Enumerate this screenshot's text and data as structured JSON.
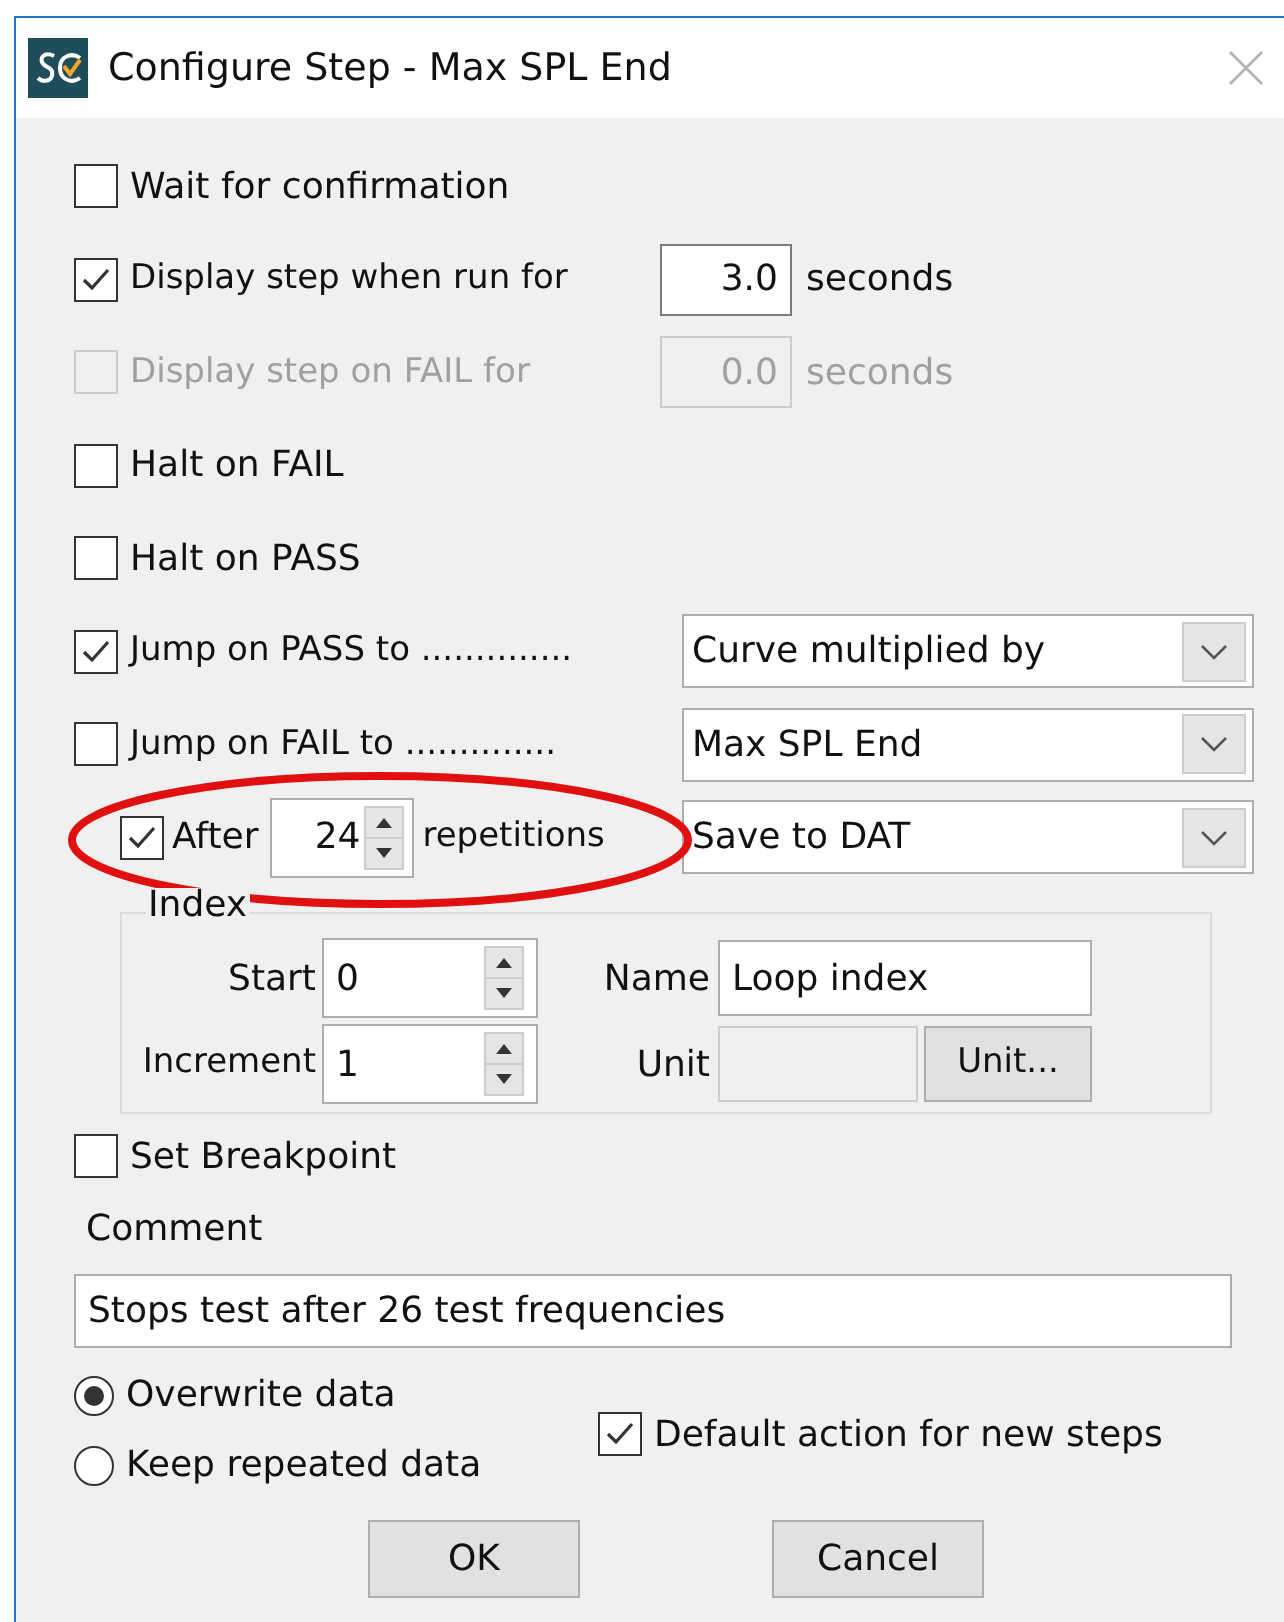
{
  "window": {
    "title": "Configure Step - Max SPL End"
  },
  "options": [
    {
      "kind": "check",
      "label": "Wait for confirmation",
      "checked": false
    },
    {
      "kind": "timed",
      "label": "Display step when run for",
      "checked": true,
      "disabled": false,
      "value": "3.0",
      "unit": "seconds"
    },
    {
      "kind": "timed",
      "label": "Display step on FAIL for",
      "checked": false,
      "disabled": true,
      "value": "0.0",
      "unit": "seconds"
    },
    {
      "kind": "check",
      "label": "Halt on FAIL",
      "checked": false
    },
    {
      "kind": "check",
      "label": "Halt on PASS",
      "checked": false
    },
    {
      "kind": "jump",
      "label": "Jump on PASS to ..............",
      "checked": true,
      "target": "Curve multiplied by"
    },
    {
      "kind": "jump",
      "label": "Jump on FAIL to ..............",
      "checked": false,
      "target": "Max SPL End"
    },
    {
      "kind": "repeat",
      "label": "After",
      "checked": true,
      "count": "24",
      "suffix": "repetitions",
      "target": "Save to DAT"
    }
  ],
  "index": {
    "title": "Index",
    "start_label": "Start",
    "start": "0",
    "increment_label": "Increment",
    "increment": "1",
    "name_label": "Name",
    "name": "Loop index",
    "unit_label": "Unit",
    "unit_button": "Unit..."
  },
  "breakpoint": {
    "label": "Set Breakpoint",
    "checked": false
  },
  "comment": {
    "label": "Comment",
    "value": "Stops test after 26 test frequencies"
  },
  "data_mode": [
    {
      "label": "Overwrite data",
      "selected": true
    },
    {
      "label": "Keep repeated data",
      "selected": false
    }
  ],
  "default_action": {
    "label": "Default action for new steps",
    "checked": true
  },
  "buttons": [
    "OK",
    "Cancel"
  ]
}
